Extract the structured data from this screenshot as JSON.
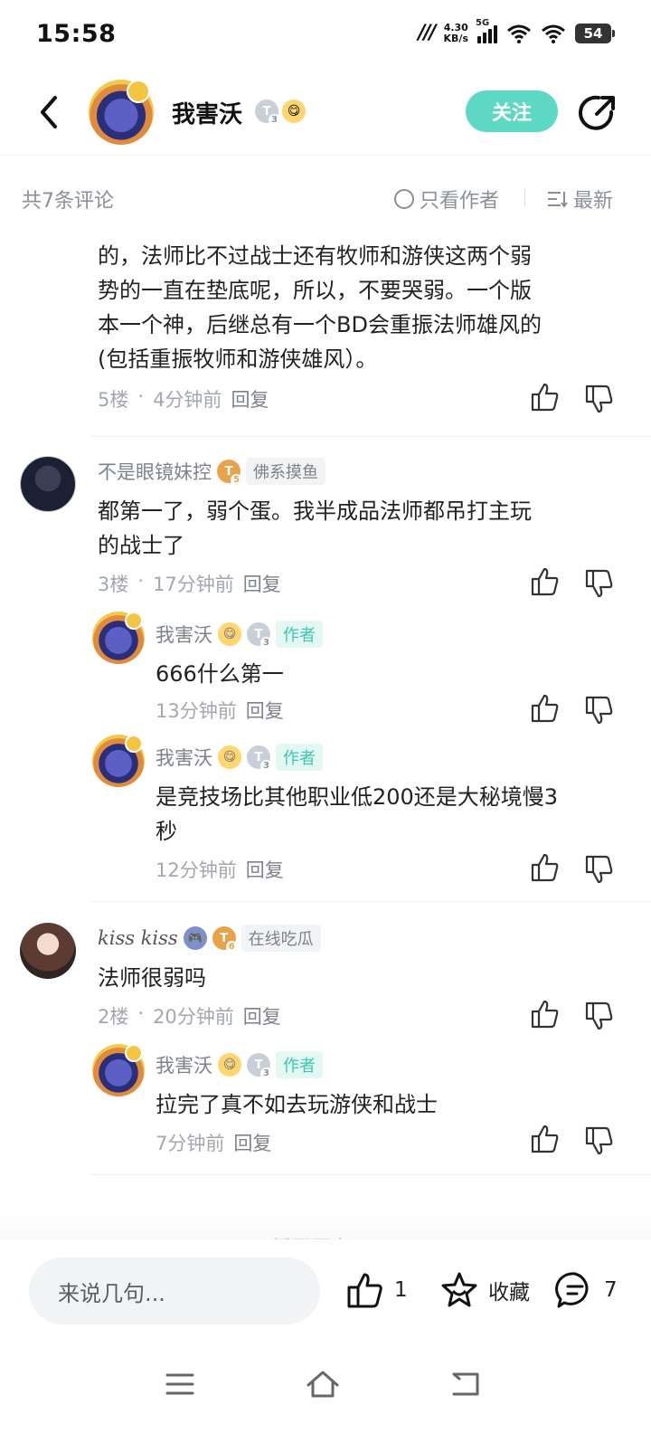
{
  "status_bar": {
    "time": "15:58",
    "net_speed_value": "4.30",
    "net_speed_unit": "KB/s",
    "network": "5G",
    "battery": "54"
  },
  "header": {
    "author_name": "我害沃",
    "follow_label": "关注",
    "level_badge": "T3"
  },
  "comment_bar": {
    "count_label": "共7条评论",
    "only_author_label": "只看作者",
    "sort_label": "最新"
  },
  "comments": [
    {
      "text_lines": [
        "的，法师比不过战士还有牧师和游侠这两个弱",
        "势的一直在垫底呢，所以，不要哭弱。一个版",
        "本一个神，后继总有一个BD会重振法师雄风的",
        "(包括重振牧师和游侠雄风）。"
      ],
      "floor": "5楼",
      "time": "4分钟前",
      "reply_label": "回复"
    },
    {
      "user": "不是眼镜妹控",
      "level": "5",
      "tag": "佛系摸鱼",
      "text_lines": [
        "都第一了，弱个蛋。我半成品法师都吊打主玩",
        "的战士了"
      ],
      "floor": "3楼",
      "time": "17分钟前",
      "reply_label": "回复",
      "replies": [
        {
          "user": "我害沃",
          "level": "3",
          "tag": "作者",
          "text_lines": [
            "666什么第一"
          ],
          "time": "13分钟前",
          "reply_label": "回复"
        },
        {
          "user": "我害沃",
          "level": "3",
          "tag": "作者",
          "text_lines": [
            "是竞技场比其他职业低200还是大秘境慢3",
            "秒"
          ],
          "time": "12分钟前",
          "reply_label": "回复"
        }
      ]
    },
    {
      "user": "kiss kiss",
      "level": "6",
      "tag": "在线吃瓜",
      "text_lines": [
        "法师很弱吗"
      ],
      "floor": "2楼",
      "time": "20分钟前",
      "reply_label": "回复",
      "replies": [
        {
          "user": "我害沃",
          "level": "3",
          "tag": "作者",
          "text_lines": [
            "拉完了真不如去玩游侠和战士"
          ],
          "time": "7分钟前",
          "reply_label": "回复"
        }
      ]
    }
  ],
  "next_page_hint": "暂无更多",
  "bottom_bar": {
    "input_placeholder": "来说几句...",
    "like_count": "1",
    "favorite_label": "收藏",
    "comment_count": "7"
  },
  "colors": {
    "accent": "#5dd8c4",
    "meta_gray": "#a3a7af",
    "author_tag": "#3ec7b0"
  }
}
